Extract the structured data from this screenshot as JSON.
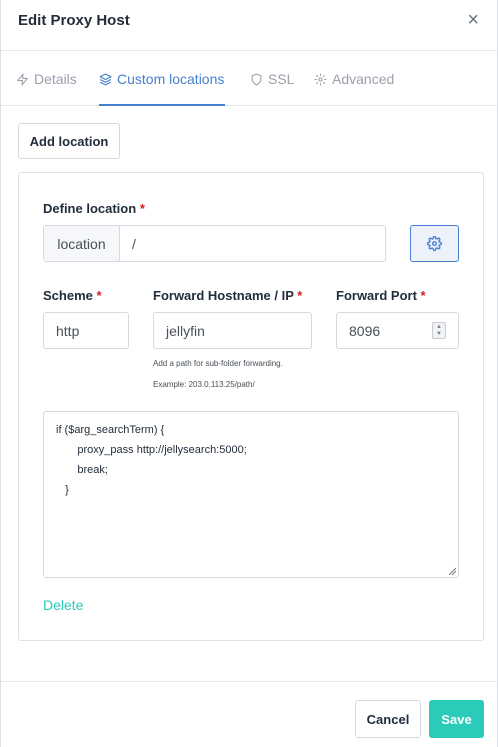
{
  "dialog": {
    "title": "Edit Proxy Host",
    "close_symbol": "×"
  },
  "tabs": [
    {
      "label": "Details",
      "icon": "bolt-icon",
      "active": false
    },
    {
      "label": "Custom locations",
      "icon": "layers-icon",
      "active": true
    },
    {
      "label": "SSL",
      "icon": "shield-icon",
      "active": false
    },
    {
      "label": "Advanced",
      "icon": "gear-icon",
      "active": false
    }
  ],
  "add_location_label": "Add location",
  "location": {
    "define_label": "Define location",
    "required_mark": "*",
    "prefix": "location",
    "path_value": "/",
    "scheme_label": "Scheme",
    "scheme_value": "http",
    "hostname_label": "Forward Hostname / IP",
    "hostname_value": "jellyfin",
    "hostname_hint": "Add a path for sub-folder forwarding.",
    "hostname_example": "Example: 203.0.113.25/path/",
    "port_label": "Forward Port",
    "port_value": "8096",
    "config_text": "if ($arg_searchTerm) {\n       proxy_pass http://jellysearch:5000;\n       break;\n   }",
    "delete_label": "Delete"
  },
  "footer": {
    "cancel_label": "Cancel",
    "save_label": "Save"
  },
  "colors": {
    "accent_blue": "#467fcf",
    "teal": "#2bcbba",
    "required_red": "#cd201f"
  }
}
